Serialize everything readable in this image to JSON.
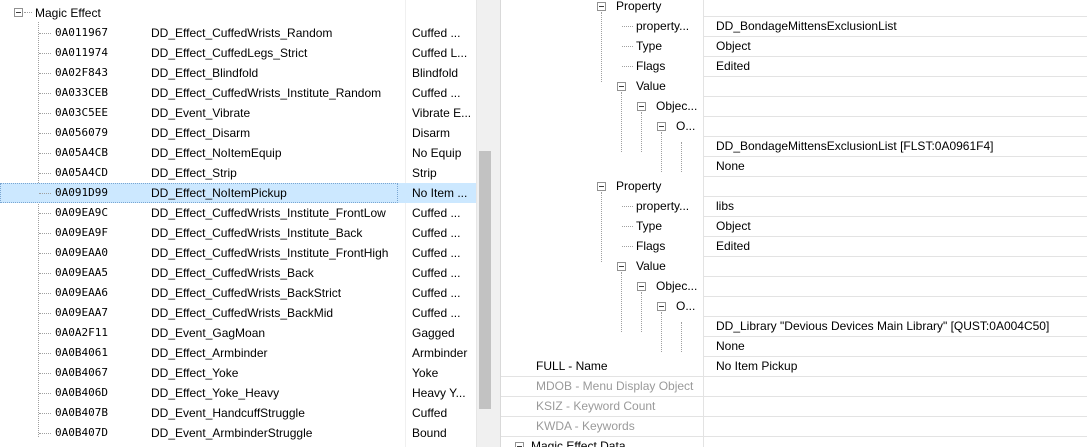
{
  "left_tree": {
    "root_label": "Magic Effect",
    "rows": [
      {
        "form_id": "0A011967",
        "editor_id": "DD_Effect_CuffedWrists_Random",
        "name": "Cuffed ..."
      },
      {
        "form_id": "0A011974",
        "editor_id": "DD_Effect_CuffedLegs_Strict",
        "name": "Cuffed L..."
      },
      {
        "form_id": "0A02F843",
        "editor_id": "DD_Effect_Blindfold",
        "name": "Blindfold"
      },
      {
        "form_id": "0A033CEB",
        "editor_id": "DD_Effect_CuffedWrists_Institute_Random",
        "name": "Cuffed ..."
      },
      {
        "form_id": "0A03C5EE",
        "editor_id": "DD_Event_Vibrate",
        "name": "Vibrate E..."
      },
      {
        "form_id": "0A056079",
        "editor_id": "DD_Effect_Disarm",
        "name": "Disarm"
      },
      {
        "form_id": "0A05A4CB",
        "editor_id": "DD_Effect_NoItemEquip",
        "name": "No Equip"
      },
      {
        "form_id": "0A05A4CD",
        "editor_id": "DD_Effect_Strip",
        "name": "Strip"
      },
      {
        "form_id": "0A091D99",
        "editor_id": "DD_Effect_NoItemPickup",
        "name": "No Item ..."
      },
      {
        "form_id": "0A09EA9C",
        "editor_id": "DD_Effect_CuffedWrists_Institute_FrontLow",
        "name": "Cuffed ..."
      },
      {
        "form_id": "0A09EA9F",
        "editor_id": "DD_Effect_CuffedWrists_Institute_Back",
        "name": "Cuffed ..."
      },
      {
        "form_id": "0A09EAA0",
        "editor_id": "DD_Effect_CuffedWrists_Institute_FrontHigh",
        "name": "Cuffed ..."
      },
      {
        "form_id": "0A09EAA5",
        "editor_id": "DD_Effect_CuffedWrists_Back",
        "name": "Cuffed ..."
      },
      {
        "form_id": "0A09EAA6",
        "editor_id": "DD_Effect_CuffedWrists_BackStrict",
        "name": "Cuffed ..."
      },
      {
        "form_id": "0A09EAA7",
        "editor_id": "DD_Effect_CuffedWrists_BackMid",
        "name": "Cuffed ..."
      },
      {
        "form_id": "0A0A2F11",
        "editor_id": "DD_Event_GagMoan",
        "name": "Gagged"
      },
      {
        "form_id": "0A0B4061",
        "editor_id": "DD_Effect_Armbinder",
        "name": "Armbinder"
      },
      {
        "form_id": "0A0B4067",
        "editor_id": "DD_Effect_Yoke",
        "name": "Yoke"
      },
      {
        "form_id": "0A0B406D",
        "editor_id": "DD_Effect_Yoke_Heavy",
        "name": "Heavy Y..."
      },
      {
        "form_id": "0A0B407B",
        "editor_id": "DD_Event_HandcuffStruggle",
        "name": "Cuffed"
      },
      {
        "form_id": "0A0B407D",
        "editor_id": "DD_Event_ArmbinderStruggle",
        "name": "Bound"
      }
    ],
    "selected_index": 8
  },
  "right_tree": {
    "rows": [
      {
        "label": "Property",
        "value": ""
      },
      {
        "label": "property...",
        "value": "DD_BondageMittensExclusionList"
      },
      {
        "label": "Type",
        "value": "Object"
      },
      {
        "label": "Flags",
        "value": "Edited"
      },
      {
        "label": "Value",
        "value": ""
      },
      {
        "label": "Objec...",
        "value": ""
      },
      {
        "label": "O...",
        "value": ""
      },
      {
        "label": "",
        "value": "DD_BondageMittensExclusionList [FLST:0A0961F4]"
      },
      {
        "label": "",
        "value": "None"
      },
      {
        "label": "Property",
        "value": ""
      },
      {
        "label": "property...",
        "value": "libs"
      },
      {
        "label": "Type",
        "value": "Object"
      },
      {
        "label": "Flags",
        "value": "Edited"
      },
      {
        "label": "Value",
        "value": ""
      },
      {
        "label": "Objec...",
        "value": ""
      },
      {
        "label": "O...",
        "value": ""
      },
      {
        "label": "",
        "value": "DD_Library \"Devious Devices Main Library\" [QUST:0A004C50]"
      },
      {
        "label": "",
        "value": "None"
      },
      {
        "label": "FULL - Name",
        "value": "No Item Pickup"
      },
      {
        "label": "MDOB - Menu Display Object",
        "value": ""
      },
      {
        "label": "KSIZ - Keyword Count",
        "value": ""
      },
      {
        "label": "KWDA - Keywords",
        "value": ""
      },
      {
        "label": "Magic Effect Data",
        "value": ""
      }
    ]
  }
}
